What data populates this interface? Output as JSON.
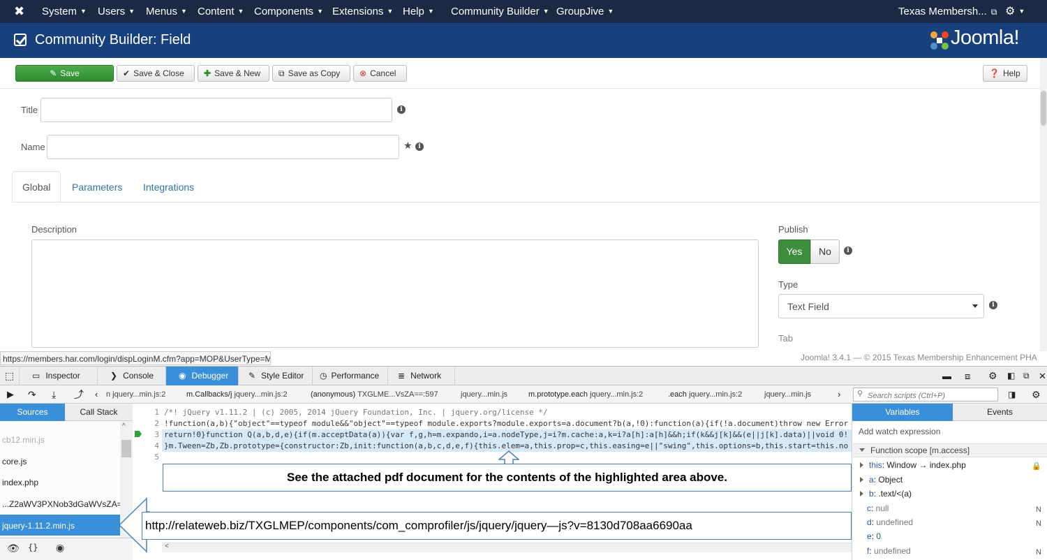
{
  "navbar": {
    "menus": [
      "System",
      "Users",
      "Menus",
      "Content",
      "Components",
      "Extensions",
      "Help",
      "Community Builder",
      "GroupJive"
    ],
    "site_name": "Texas Membersh..."
  },
  "titlebar": {
    "title": "Community Builder: Field",
    "logo_text": "Joomla!"
  },
  "toolbar": {
    "save": "Save",
    "save_close": "Save & Close",
    "save_new": "Save & New",
    "save_copy": "Save as Copy",
    "cancel": "Cancel",
    "help": "Help"
  },
  "form": {
    "title_label": "Title",
    "title_value": "",
    "name_label": "Name",
    "name_value": "",
    "tabs": [
      "Global",
      "Parameters",
      "Integrations"
    ],
    "description_label": "Description",
    "publish_label": "Publish",
    "publish_yes": "Yes",
    "publish_no": "No",
    "type_label": "Type",
    "type_value": "Text Field",
    "tab_label": "Tab"
  },
  "status_url": "https://members.har.com/login/dispLoginM.cfm?app=MOP&UserType=M",
  "footer": "Joomla! 3.4.1 — © 2015 Texas Membership Enhancement PHA",
  "devtools": {
    "tabs": [
      "Inspector",
      "Console",
      "Debugger",
      "Style Editor",
      "Performance",
      "Network"
    ],
    "crumbs": [
      {
        "fn": "",
        "file": "n jquery...min.js:2"
      },
      {
        "fn": "m.Callbacks/j",
        "file": "jquery...min.js:2"
      },
      {
        "fn": "(anonymous)",
        "file": "TXGLME...VsZA==:597"
      },
      {
        "fn": "",
        "file": "jquery...min.js"
      },
      {
        "fn": "m.prototype.each",
        "file": "jquery...min.js:2"
      },
      {
        "fn": ".each",
        "file": "jquery...min.js:2"
      },
      {
        "fn": "",
        "file": "jquery...min.js"
      }
    ],
    "search_placeholder": "Search scripts (Ctrl+P)",
    "sidebar_tabs": [
      "Sources",
      "Call Stack"
    ],
    "sources": [
      "cb12.min.js",
      "core.js",
      "index.php",
      "...Z2aWV3PXNob3dGaWVsZA==",
      "jquery-1.11.2.min.js"
    ],
    "code_lines": [
      {
        "num": "1",
        "text": "/*! jQuery v1.11.2 | (c) 2005, 2014 jQuery Foundation, Inc. | jquery.org/license */"
      },
      {
        "num": "2",
        "text": "!function(a,b){\"object\"==typeof module&&\"object\"==typeof module.exports?module.exports=a.document?b(a,!0):function(a){if(!a.document)throw new Error"
      },
      {
        "num": "3",
        "text": "return!0}function Q(a,b,d,e){if(m.acceptData(a)){var f,g,h=m.expando,i=a.nodeType,j=i?m.cache:a,k=i?a[h]:a[h]&&h;if(k&&j[k]&&(e||j[k].data)||void 0!"
      },
      {
        "num": "4",
        "text": "}m.Tween=Zb,Zb.prototype={constructor:Zb,init:function(a,b,c,d,e,f){this.elem=a,this.prop=c,this.easing=e||\"swing\",this.options=b,this.start=this.no"
      },
      {
        "num": "5",
        "text": ""
      }
    ],
    "note": "See the attached pdf document for the contents of the highlighted area above.",
    "url_note": "http://relateweb.biz/TXGLMEP/components/com_comprofiler/js/jquery/jquery—js?v=8130d708aa6690aa",
    "vars_tabs": [
      "Variables",
      "Events"
    ],
    "watch": "Add watch expression",
    "scope": "Function scope [m.access]",
    "variables": [
      {
        "name": "this",
        "value": "Window → index.php",
        "right": "",
        "expand": true
      },
      {
        "name": "a",
        "value": "Object",
        "right": "",
        "expand": true
      },
      {
        "name": "b",
        "value": ".text/<(a)",
        "right": "",
        "expand": true
      },
      {
        "name": "c",
        "value": "null",
        "right": "N",
        "expand": false
      },
      {
        "name": "d",
        "value": "undefined",
        "right": "N",
        "expand": false
      },
      {
        "name": "e",
        "value": "0",
        "right": "",
        "expand": false
      },
      {
        "name": "f",
        "value": "undefined",
        "right": "N",
        "expand": false
      }
    ]
  }
}
